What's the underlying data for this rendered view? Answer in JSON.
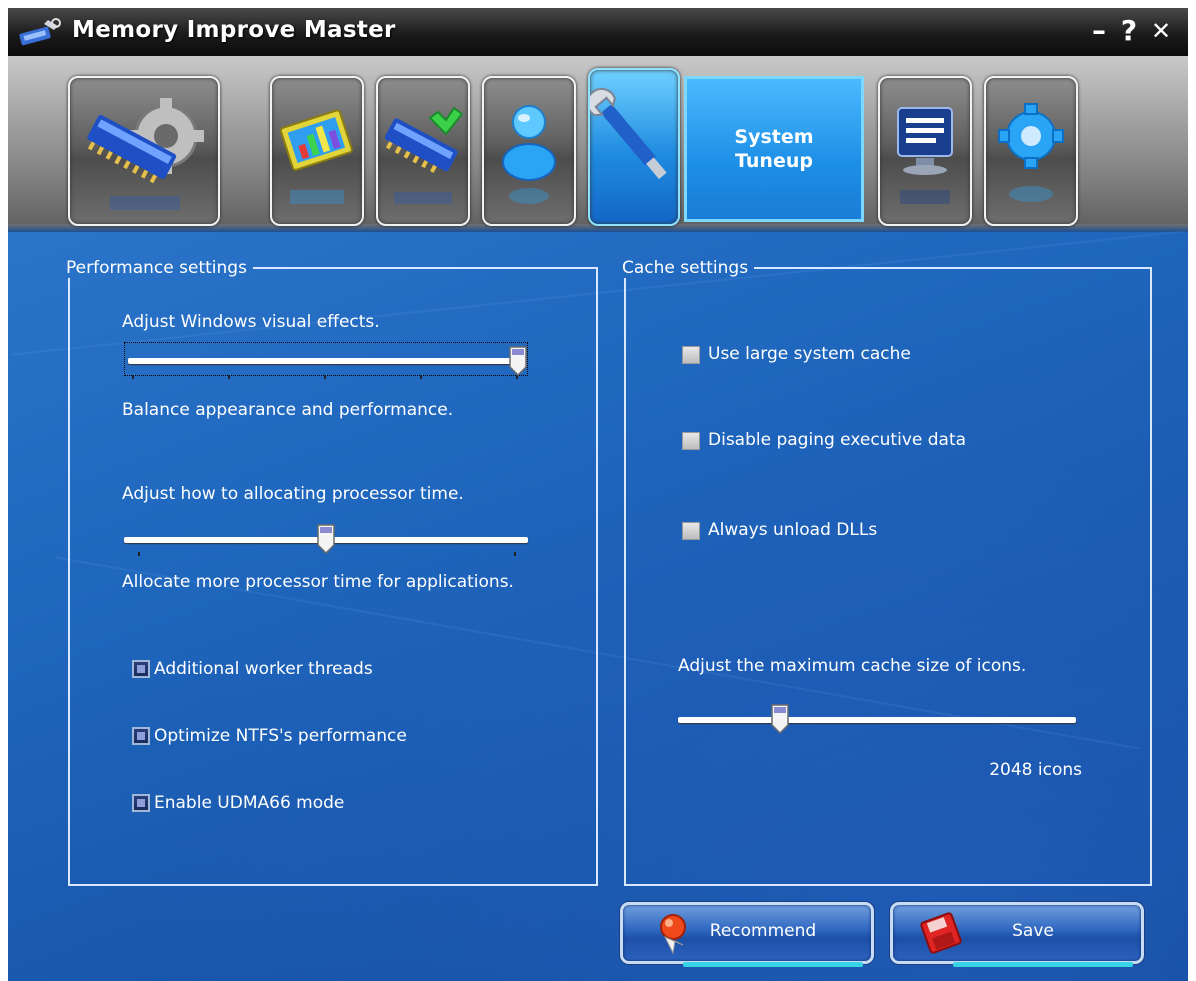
{
  "window": {
    "title": "Memory Improve Master",
    "controls": {
      "minimize": "–",
      "help": "?",
      "close": "✕"
    }
  },
  "toolbar": {
    "active_tab_label": "System\nTuneup",
    "tabs": [
      {
        "id": "memory-optimize",
        "icon": "memory-gear-icon"
      },
      {
        "id": "statistics",
        "icon": "chart-monitor-icon"
      },
      {
        "id": "memory-check",
        "icon": "memory-check-icon"
      },
      {
        "id": "user",
        "icon": "user-icon"
      },
      {
        "id": "system-tuneup",
        "icon": "wrench-icon",
        "active": true
      },
      {
        "id": "system-info",
        "icon": "computer-list-icon"
      },
      {
        "id": "settings",
        "icon": "gear-icon"
      }
    ]
  },
  "performance": {
    "legend": "Performance settings",
    "visual_effects": {
      "label": "Adjust Windows visual effects.",
      "caption": "Balance appearance and performance.",
      "level": 1.0
    },
    "processor_time": {
      "label": "Adjust how to allocating processor time.",
      "caption": "Allocate more processor time for applications.",
      "level": 0.5
    },
    "checkboxes": [
      {
        "label": "Additional worker threads",
        "checked": true
      },
      {
        "label": "Optimize NTFS's performance",
        "checked": true
      },
      {
        "label": "Enable UDMA66 mode",
        "checked": true
      }
    ]
  },
  "cache": {
    "legend": "Cache settings",
    "checkboxes": [
      {
        "label": "Use large system cache",
        "checked": false
      },
      {
        "label": "Disable paging executive data",
        "checked": false
      },
      {
        "label": "Always unload DLLs",
        "checked": false
      }
    ],
    "icon_cache": {
      "label": "Adjust the maximum cache size of icons.",
      "value_text": "2048 icons",
      "level": 0.25
    }
  },
  "actions": {
    "recommend": "Recommend",
    "save": "Save"
  },
  "colors": {
    "background": "#1a5fb0",
    "accent": "#7cd8ff",
    "title_bar": "#1b1b1b"
  }
}
